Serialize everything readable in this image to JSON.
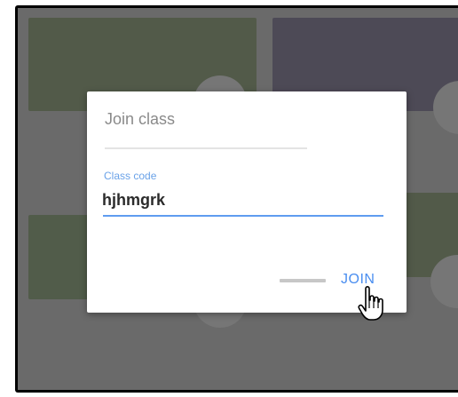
{
  "dialog": {
    "title": "Join class",
    "field_label": "Class code",
    "field_value": "hjhmgrk",
    "join_label": "JOIN"
  },
  "colors": {
    "accent": "#4a8ef0",
    "overlay": "#6a6a6a"
  },
  "icons": {
    "pointer": "hand-pointer-icon"
  }
}
